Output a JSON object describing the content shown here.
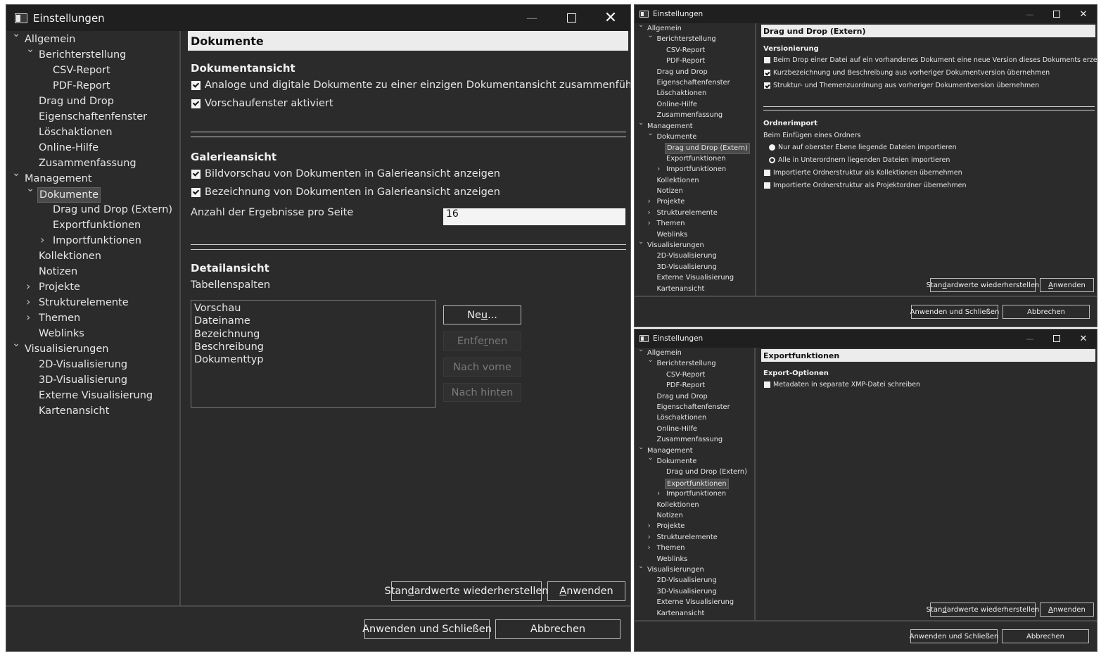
{
  "nav_tree": [
    {
      "label": "Allgemein",
      "level": 0,
      "arrow": "down"
    },
    {
      "label": "Berichterstellung",
      "level": 1,
      "arrow": "down"
    },
    {
      "label": "CSV-Report",
      "level": 2,
      "arrow": ""
    },
    {
      "label": "PDF-Report",
      "level": 2,
      "arrow": ""
    },
    {
      "label": "Drag und Drop",
      "level": 1,
      "arrow": ""
    },
    {
      "label": "Eigenschaftenfenster",
      "level": 1,
      "arrow": ""
    },
    {
      "label": "Löschaktionen",
      "level": 1,
      "arrow": ""
    },
    {
      "label": "Online-Hilfe",
      "level": 1,
      "arrow": ""
    },
    {
      "label": "Zusammenfassung",
      "level": 1,
      "arrow": ""
    },
    {
      "label": "Management",
      "level": 0,
      "arrow": "down"
    },
    {
      "label": "Dokumente",
      "level": 1,
      "arrow": "down"
    },
    {
      "label": "Drag und Drop (Extern)",
      "level": 2,
      "arrow": ""
    },
    {
      "label": "Exportfunktionen",
      "level": 2,
      "arrow": ""
    },
    {
      "label": "Importfunktionen",
      "level": 2,
      "arrow": "right"
    },
    {
      "label": "Kollektionen",
      "level": 1,
      "arrow": ""
    },
    {
      "label": "Notizen",
      "level": 1,
      "arrow": ""
    },
    {
      "label": "Projekte",
      "level": 1,
      "arrow": "right"
    },
    {
      "label": "Strukturelemente",
      "level": 1,
      "arrow": "right"
    },
    {
      "label": "Themen",
      "level": 1,
      "arrow": "right"
    },
    {
      "label": "Weblinks",
      "level": 1,
      "arrow": ""
    },
    {
      "label": "Visualisierungen",
      "level": 0,
      "arrow": "down"
    },
    {
      "label": "2D-Visualisierung",
      "level": 1,
      "arrow": ""
    },
    {
      "label": "3D-Visualisierung",
      "level": 1,
      "arrow": ""
    },
    {
      "label": "Externe Visualisierung",
      "level": 1,
      "arrow": ""
    },
    {
      "label": "Kartenansicht",
      "level": 1,
      "arrow": ""
    }
  ],
  "common": {
    "window_title": "Einstellungen",
    "btn_restore_pre": "Stan",
    "btn_restore_u": "d",
    "btn_restore_post": "ardwerte wiederherstellen",
    "btn_apply_u": "A",
    "btn_apply_post": "nwenden",
    "btn_apply_close": "Anwenden und Schließen",
    "btn_cancel": "Abbrechen"
  },
  "win1": {
    "selected_nav": "Dokumente",
    "page_title": "Dokumente",
    "sec1_title": "Dokumentansicht",
    "cb1_label": "Analoge und digitale Dokumente zu einer einzigen Dokumentansicht zusammenführen",
    "cb1_checked": true,
    "cb2_label": "Vorschaufenster aktiviert",
    "cb2_checked": true,
    "sec2_title": "Galerieansicht",
    "cb3_label": "Bildvorschau von Dokumenten in Galerieansicht anzeigen",
    "cb3_checked": true,
    "cb4_label": "Bezeichnung von Dokumenten in Galerieansicht anzeigen",
    "cb4_checked": true,
    "results_label": "Anzahl der Ergebnisse pro Seite",
    "results_value": "16",
    "sec3_title": "Detailansicht",
    "columns_label": "Tabellenspalten",
    "columns": [
      "Vorschau",
      "Dateiname",
      "Bezeichnung",
      "Beschreibung",
      "Dokumenttyp"
    ],
    "btn_new_pre": "Ne",
    "btn_new_u": "u",
    "btn_new_post": "...",
    "btn_remove_pre": "Entfe",
    "btn_remove_u": "r",
    "btn_remove_post": "nen",
    "btn_forward": "Nach vorne",
    "btn_back": "Nach hinten"
  },
  "win2": {
    "selected_nav": "Drag und Drop (Extern)",
    "page_title": "Drag und Drop (Extern)",
    "sec1_title": "Versionierung",
    "cb1_label": "Beim Drop einer Datei auf ein vorhandenes Dokument eine neue Version dieses Dokuments erzeugen",
    "cb1_checked": false,
    "cb2_label": "Kurzbezeichnung und Beschreibung aus vorheriger Dokumentversion übernehmen",
    "cb2_checked": true,
    "cb3_label": "Struktur- und Themenzuordnung aus vorheriger Dokumentversion übernehmen",
    "cb3_checked": true,
    "sec2_title": "Ordnerimport",
    "folder_label": "Beim Einfügen eines Ordners",
    "radio1_label": "Nur auf oberster Ebene liegende Dateien importieren",
    "radio1_selected": true,
    "radio2_label": "Alle in Unterordnern liegenden Dateien importieren",
    "radio2_selected": false,
    "cb4_label": "Importierte Ordnerstruktur als Kollektionen übernehmen",
    "cb4_checked": false,
    "cb5_label": "Importierte Ordnerstruktur als Projektordner übernehmen",
    "cb5_checked": false
  },
  "win3": {
    "selected_nav": "Exportfunktionen",
    "page_title": "Exportfunktionen",
    "sec1_title": "Export-Optionen",
    "cb1_label": "Metadaten in separate XMP-Datei schreiben",
    "cb1_checked": false
  }
}
